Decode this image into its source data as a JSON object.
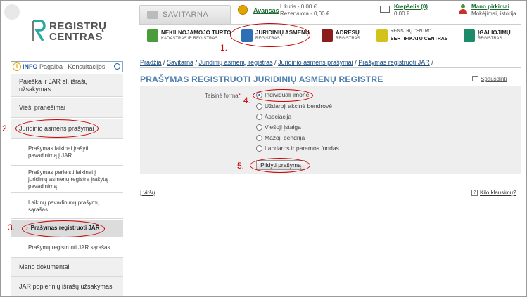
{
  "logo": {
    "line1": "REGISTRŲ",
    "line2": "CENTRAS"
  },
  "header": {
    "savitarna": "SAVITARNA",
    "avansas": "Avansas",
    "likutis": "Likutis - 0,00 €",
    "rezervuota": "Rezervuota - 0,00 €",
    "krepselis": "Krepšelis (0)",
    "krepselis_sum": "0,00 €",
    "mano_pirkimai": "Mano pirkimai",
    "mano_sub": "Mokėjimai, istorija"
  },
  "registries": [
    {
      "line1": "NEKILNOJAMOJO TURTO",
      "line2": "KADASTRAS IR REGISTRAS",
      "icon_color": "#4a9c3b"
    },
    {
      "line1": "JURIDINIŲ ASMENŲ",
      "line2": "REGISTRAS",
      "icon_color": "#2e6fb5"
    },
    {
      "line1": "ADRESŲ",
      "line2": "REGISTRAS",
      "icon_color": "#8b1d1d"
    },
    {
      "line1": "REGISTRŲ CENTRO",
      "line2": "SERTIFIKATŲ CENTRAS",
      "icon_color": "#d4c21c"
    },
    {
      "line1": "ĮGALIOJIMŲ",
      "line2": "REGISTRAS",
      "icon_color": "#1d8a6a"
    }
  ],
  "annotations": [
    "1.",
    "2.",
    "3.",
    "4.",
    "5."
  ],
  "sidebar": {
    "info": "INFO",
    "pagalba": "Pagalba",
    "konsultacijos": "Konsultacijos",
    "items": [
      {
        "label": "Paieška ir JAR el. išrašų užsakymas"
      },
      {
        "label": "Vieši pranešimai"
      },
      {
        "label": "Juridinio asmens prašymai"
      },
      {
        "label": "Prašymas laikinai įrašyti pavadinimą į JAR"
      },
      {
        "label": "Prašymas perleisti laikinai į juridinių asmenų registrą įrašytą pavadinimą"
      },
      {
        "label": "Laikinų pavadinimų prašymų sąrašas"
      },
      {
        "label": "Prašymas registruoti JAR"
      },
      {
        "label": "Prašymų registruoti JAR sąrašas"
      },
      {
        "label": "Mano dokumentai"
      },
      {
        "label": "JAR popierinių išrašų užsakymas"
      }
    ]
  },
  "breadcrumb": [
    {
      "label": "Pradžia"
    },
    {
      "label": "Savitarna"
    },
    {
      "label": "Juridinių asmenų registras"
    },
    {
      "label": "Juridinio asmens prašymai"
    },
    {
      "label": "Prašymas registruoti JAR"
    }
  ],
  "main": {
    "title": "PRAŠYMAS REGISTRUOTI JURIDINIŲ ASMENŲ REGISTRE",
    "print_label": "Spausdinti",
    "form_label": "Teisinė forma",
    "required_mark": "*",
    "options": [
      {
        "label": "Individuali įmonė",
        "checked": true
      },
      {
        "label": "Uždaroji akcinė bendrovė",
        "checked": false
      },
      {
        "label": "Asociacija",
        "checked": false
      },
      {
        "label": "Viešoji įstaiga",
        "checked": false
      },
      {
        "label": "Mažoji bendrija",
        "checked": false
      },
      {
        "label": "Labdaros ir paramos fondas",
        "checked": false
      }
    ],
    "submit_label": "Pildyti prašymą",
    "to_top": "Į viršų",
    "questions": "Kilo klausimų?"
  }
}
